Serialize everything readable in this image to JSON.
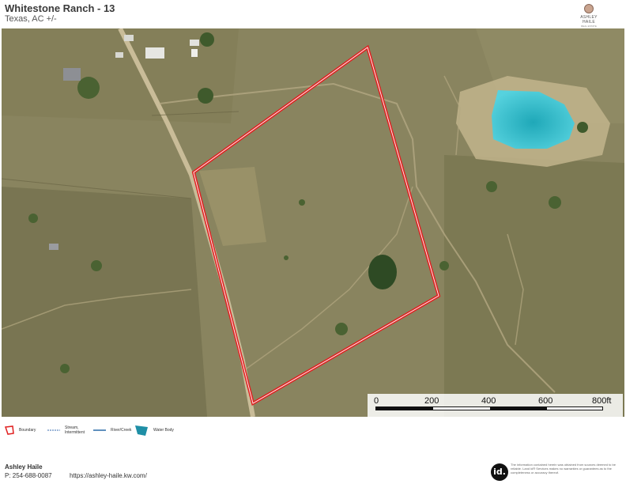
{
  "header": {
    "title": "Whitestone Ranch - 13",
    "subtitle": "Texas,  AC +/-",
    "brand_name": "ASHLEY HAILE",
    "brand_sub": "REAL ESTATE"
  },
  "map": {
    "scale": {
      "labels": [
        "0",
        "200",
        "400",
        "600",
        "800ft"
      ],
      "colors": [
        "#111111",
        "#ffffff"
      ]
    },
    "colors": {
      "boundary": "#e02020",
      "water": "#3fc4d4",
      "terrain": "#8a8760"
    }
  },
  "legend": {
    "items": [
      {
        "icon": "boundary-icon",
        "label": "Boundary"
      },
      {
        "icon": "stream-icon",
        "label": "Stream, Intermittent"
      },
      {
        "icon": "river-icon",
        "label": "River/Creek"
      },
      {
        "icon": "water-body-icon",
        "label": "Water Body"
      }
    ]
  },
  "footer": {
    "agent_name": "Ashley Haile",
    "agent_phone": "P: 254-688-0087",
    "agent_url": "https://ashley-haile.kw.com/",
    "logo_text": "id.",
    "disclaimer": "The information contained herein was obtained from sources deemed to be reliable. Land id® Services makes no warranties or guarantees as to the completeness or accuracy thereof."
  }
}
